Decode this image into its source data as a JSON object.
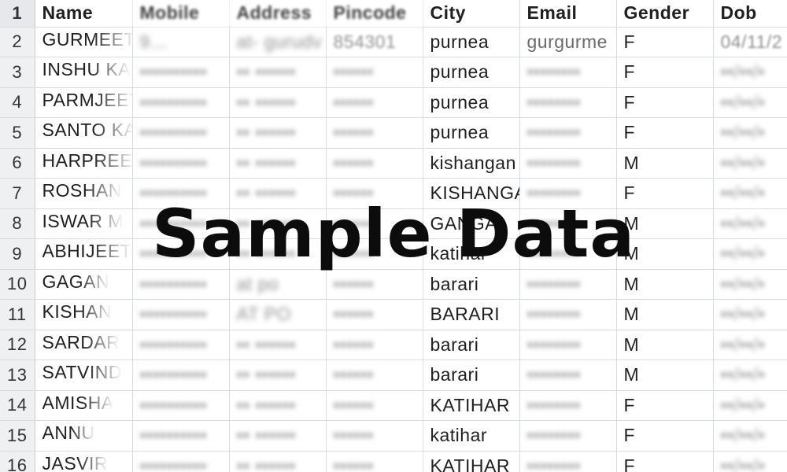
{
  "columns": [
    "Name",
    "Mobile",
    "Address",
    "Pincode",
    "City",
    "Email",
    "Gender",
    "Dob"
  ],
  "header_row_number": "1",
  "rows": [
    {
      "num": "2",
      "name": "GURMEET",
      "mobile": "9…",
      "address": "at- gurudv",
      "pincode": "854301",
      "city": "purnea",
      "email": "gurgurme",
      "gender": "F",
      "dob": "04/11/2"
    },
    {
      "num": "3",
      "name": "INSHU KA",
      "mobile": "",
      "address": "",
      "pincode": "",
      "city": "purnea",
      "email": "",
      "gender": "F",
      "dob": ""
    },
    {
      "num": "4",
      "name": "PARMJEET",
      "mobile": "",
      "address": "",
      "pincode": "",
      "city": "purnea",
      "email": "",
      "gender": "F",
      "dob": ""
    },
    {
      "num": "5",
      "name": "SANTO KA",
      "mobile": "",
      "address": "",
      "pincode": "",
      "city": "purnea",
      "email": "",
      "gender": "F",
      "dob": ""
    },
    {
      "num": "6",
      "name": "HARPREET",
      "mobile": "",
      "address": "",
      "pincode": "",
      "city": "kishangan",
      "email": "",
      "gender": "M",
      "dob": ""
    },
    {
      "num": "7",
      "name": "ROSHAN",
      "mobile": "",
      "address": "",
      "pincode": "",
      "city": "KISHANGANJ",
      "email": "",
      "gender": "F",
      "dob": ""
    },
    {
      "num": "8",
      "name": "ISWAR M",
      "mobile": "",
      "address": "",
      "pincode": "",
      "city": "GANGAL",
      "email": "",
      "gender": "M",
      "dob": ""
    },
    {
      "num": "9",
      "name": "ABHIJEET",
      "mobile": "",
      "address": "",
      "pincode": "",
      "city": "katihar",
      "email": "",
      "gender": "M",
      "dob": ""
    },
    {
      "num": "10",
      "name": "GAGAN",
      "mobile": "",
      "address": "at po",
      "pincode": "",
      "city": "barari",
      "email": "",
      "gender": "M",
      "dob": ""
    },
    {
      "num": "11",
      "name": "KISHAN",
      "mobile": "",
      "address": "AT PO",
      "pincode": "",
      "city": "BARARI",
      "email": "",
      "gender": "M",
      "dob": ""
    },
    {
      "num": "12",
      "name": "SARDAR",
      "mobile": "",
      "address": "",
      "pincode": "",
      "city": "barari",
      "email": "",
      "gender": "M",
      "dob": ""
    },
    {
      "num": "13",
      "name": "SATVIND",
      "mobile": "",
      "address": "",
      "pincode": "",
      "city": "barari",
      "email": "",
      "gender": "M",
      "dob": ""
    },
    {
      "num": "14",
      "name": "AMISHA",
      "mobile": "",
      "address": "",
      "pincode": "",
      "city": "KATIHAR",
      "email": "",
      "gender": "F",
      "dob": ""
    },
    {
      "num": "15",
      "name": "ANNU",
      "mobile": "",
      "address": "",
      "pincode": "",
      "city": "katihar",
      "email": "",
      "gender": "F",
      "dob": ""
    },
    {
      "num": "16",
      "name": "JASVIR",
      "mobile": "",
      "address": "",
      "pincode": "",
      "city": "KATIHAR",
      "email": "",
      "gender": "F",
      "dob": ""
    }
  ],
  "overlay": {
    "text": "Sample Data"
  }
}
